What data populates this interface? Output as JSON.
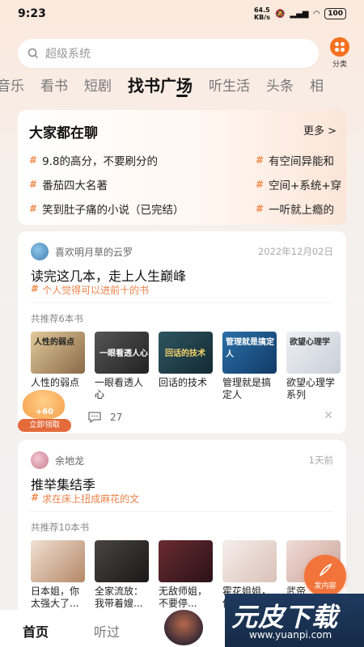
{
  "status": {
    "time": "9:23",
    "speed_value": "64.5",
    "speed_unit": "KB/s",
    "battery": "100"
  },
  "search": {
    "placeholder": "超级系统"
  },
  "category": {
    "label": "分类"
  },
  "tabs": [
    "音乐",
    "看书",
    "短剧",
    "找书广场",
    "听生活",
    "头条",
    "相"
  ],
  "hot": {
    "title": "大家都在聊",
    "more": "更多 >",
    "left": [
      "9.8的高分，不要刷分的",
      "番茄四大名著",
      "笑到肚子痛的小说（已完结）"
    ],
    "right": [
      "有空间异能和",
      "空间+系统+穿",
      "一听就上瘾的"
    ]
  },
  "post1": {
    "user": "喜欢明月草的云罗",
    "date": "2022年12月02日",
    "title": "读完这几本，走上人生巅峰",
    "tag": "个人觉得可以进前十的书",
    "count": "共推荐6本书",
    "books": [
      {
        "name": "人性的弱点",
        "cover_text": "人性的弱点",
        "color": "#c7a574"
      },
      {
        "name": "一眼看透人心",
        "cover_text": "一眼看透人心",
        "color": "#3a3a3a"
      },
      {
        "name": "回话的技术",
        "cover_text": "回话的技术",
        "color": "#24404a"
      },
      {
        "name": "管理就是搞定人",
        "cover_text": "管理就是搞定人",
        "color": "#1e5a8c"
      },
      {
        "name": "欲望心理学系列",
        "cover_text": "欲望心理学",
        "color": "#dfe3ea"
      }
    ],
    "comments": "27"
  },
  "reward": {
    "amount": "+60",
    "label": "立即领取"
  },
  "post2": {
    "user": "余地龙",
    "date": "1天前",
    "title": "推举集结季",
    "tag": "求在床上扭成麻花的文",
    "count": "共推荐10本书",
    "books": [
      {
        "name": "日本姐，你太强大了...",
        "color": "#e9d6c8"
      },
      {
        "name": "全家流放：我带着嫂...",
        "color": "#2d2a2a"
      },
      {
        "name": "无敌师姐，不要停...",
        "color": "#3a1e22"
      },
      {
        "name": "霍花姐姐，你太...",
        "color": "#f0e6e2"
      },
      {
        "name": "武帝",
        "color": "#e8d2cc"
      }
    ]
  },
  "fab": {
    "label": "发内容"
  },
  "bottom": {
    "home": "首页",
    "listened": "听过"
  },
  "watermark": {
    "big": "元皮下载",
    "small": "www.yuanpi.com"
  }
}
